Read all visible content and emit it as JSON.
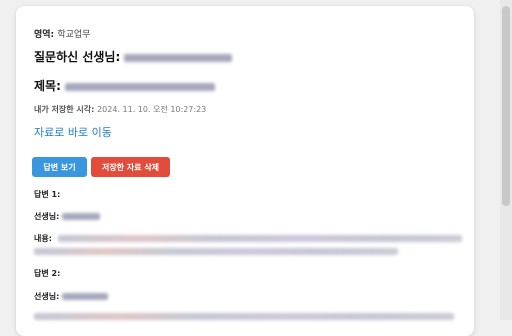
{
  "area": {
    "label": "영역:",
    "value": "학교업무"
  },
  "teacher": {
    "label": "질문하신 선생님:"
  },
  "title": {
    "label": "제목:"
  },
  "saved": {
    "label": "내가 저장한 시각:",
    "value": "2024. 11. 10. 오전 10:27:23"
  },
  "link_text": "자료로 바로 이동",
  "buttons": {
    "view": "답변 보기",
    "delete": "저장한 자료 삭제"
  },
  "answers": [
    {
      "heading": "답변 1:",
      "teacher_label": "선생님:",
      "content_label": "내용:"
    },
    {
      "heading": "답변 2:",
      "teacher_label": "선생님:"
    }
  ],
  "colors": {
    "link": "#1e7ec8",
    "view_button": "#3a96dd",
    "delete_button": "#e14c3c"
  }
}
